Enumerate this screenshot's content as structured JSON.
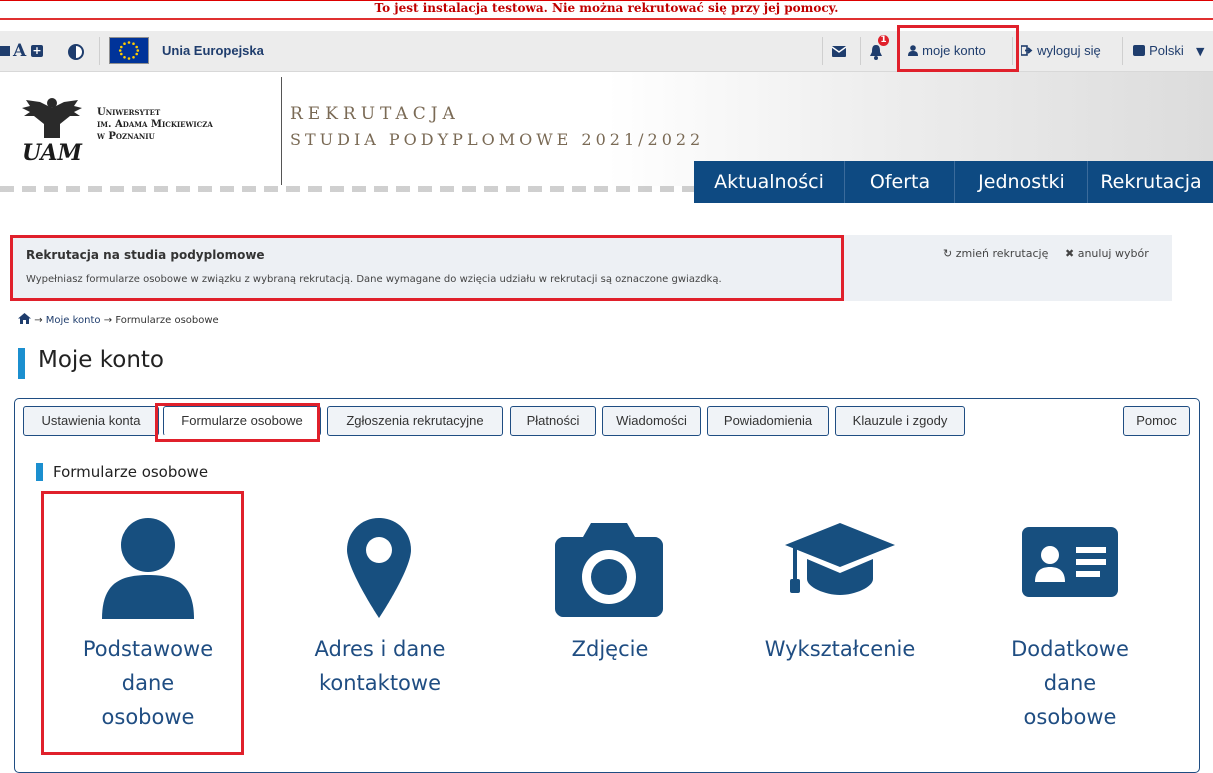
{
  "warning_text": "To jest instalacja testowa. Nie można rekrutować się przy jej pomocy.",
  "topbar": {
    "eu_label": "Unia Europejska",
    "notification_count": "1",
    "my_account": "moje konto",
    "logout": "wyloguj się",
    "language": "Polski"
  },
  "logo": {
    "line1": "Uniwersytet",
    "line2": "im. Adama Mickiewicza",
    "line3": "w Poznaniu",
    "mark": "UAM"
  },
  "header": {
    "title": "REKRUTACJA",
    "subtitle": "STUDIA PODYPLOMOWE 2021/2022"
  },
  "nav": {
    "items": [
      "Aktualności",
      "Oferta",
      "Jednostki",
      "Rekrutacja"
    ]
  },
  "info": {
    "title": "Rekrutacja na studia podyplomowe",
    "text": "Wypełniasz formularze osobowe w związku z wybraną rekrutacją. Dane wymagane do wzięcia udziału w rekrutacji są oznaczone gwiazdką.",
    "change": "zmień rekrutację",
    "cancel": "anuluj wybór"
  },
  "breadcrumb": {
    "arrow": "→",
    "items": [
      "Moje konto",
      "Formularze osobowe"
    ]
  },
  "page_title": "Moje konto",
  "tabs": [
    "Ustawienia konta",
    "Formularze osobowe",
    "Zgłoszenia rekrutacyjne",
    "Płatności",
    "Wiadomości",
    "Powiadomienia",
    "Klauzule i zgody"
  ],
  "help_tab": "Pomoc",
  "section_title": "Formularze osobowe",
  "cards": [
    {
      "icon": "user-icon",
      "lines": [
        "Podstawowe",
        "dane",
        "osobowe"
      ]
    },
    {
      "icon": "map-marker-icon",
      "lines": [
        "Adres i dane",
        "kontaktowe"
      ]
    },
    {
      "icon": "camera-icon",
      "lines": [
        "Zdjęcie"
      ]
    },
    {
      "icon": "graduation-cap-icon",
      "lines": [
        "Wykształcenie"
      ]
    },
    {
      "icon": "id-card-icon",
      "lines": [
        "Dodatkowe",
        "dane",
        "osobowe"
      ]
    }
  ],
  "colors": {
    "primary": "#0e4a82",
    "icon": "#174f7f",
    "highlight": "#e0202b",
    "accent": "#1b8fcf"
  }
}
